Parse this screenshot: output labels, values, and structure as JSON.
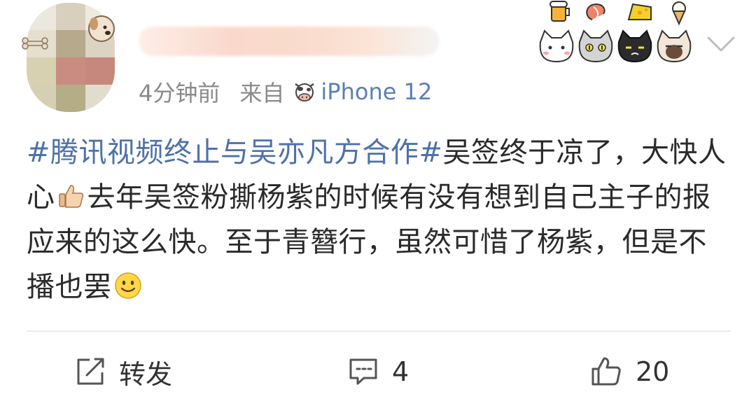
{
  "post": {
    "time": "4分钟前",
    "source_label": "来自",
    "source_icon": "cow-icon",
    "device": "iPhone 12",
    "username_visible": false
  },
  "content": {
    "topic": "#腾讯视频终止与吴亦凡方合作#",
    "text_1": "吴签终于凉了，大快人心",
    "emoji_1": "thumbs-up-icon",
    "text_2": "去年吴签粉撕杨紫的时候有没有想到自己主子的报应来的这么快。至于青簪行，虽然可惜了杨紫，但是不播也罢",
    "emoji_2": "smile-icon"
  },
  "stickers": [
    "beer-icon",
    "shrimp-icon",
    "cheese-icon",
    "ice-cream-icon",
    "white-cat-icon",
    "gray-cat-icon",
    "black-cat-icon",
    "siamese-cat-icon"
  ],
  "actions": {
    "repost_label": "转发",
    "comment_count": "4",
    "like_count": "20"
  },
  "colors": {
    "topic_link": "#4e71a8",
    "device_link": "#5b7fb5",
    "meta_text": "#8a8a8a",
    "body_text": "#2a2a2a",
    "divider": "#ececec"
  }
}
